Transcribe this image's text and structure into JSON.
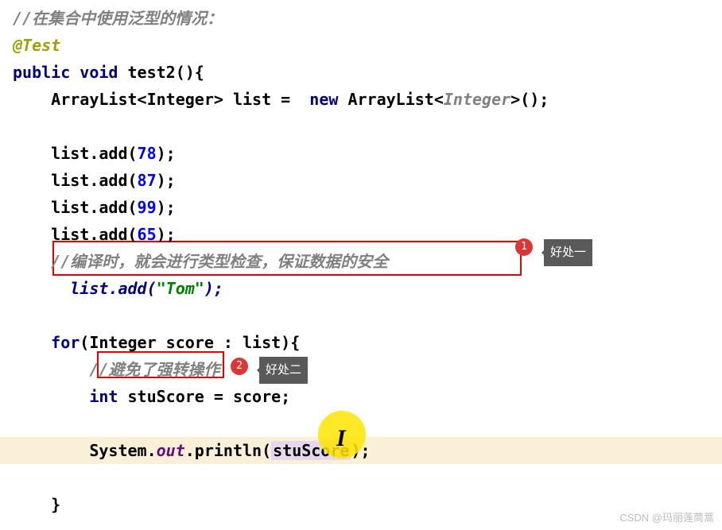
{
  "code": {
    "line1_comment": "//在集合中使用泛型的情况：",
    "line2_annotation": "@Test",
    "line3_public": "public",
    "line3_void": "void",
    "line3_method": "test2(){",
    "line4_pre": "    ArrayList<Integer> list = ",
    "line4_new": "new",
    "line4_post": " ArrayList<",
    "line4_integer": "Integer",
    "line4_end": ">();",
    "line6": "    list.add(",
    "line6_num": "78",
    "line6_end": ");",
    "line7": "    list.add(",
    "line7_num": "87",
    "line7_end": ");",
    "line8": "    list.add(",
    "line8_num": "99",
    "line8_end": ");",
    "line9": "    list.add(",
    "line9_num": "65",
    "line9_end": ");",
    "line10_comment": "    //编译时，就会进行类型检查，保证数据的安全",
    "line11_pre": "      list.add(",
    "line11_str": "\"Tom\"",
    "line11_end": ");",
    "line13_for": "for",
    "line13_rest": "(Integer score : list){",
    "line14_comment": "        //避免了强转操作",
    "line15_int": "int",
    "line15_rest": " stuScore = score;",
    "line17_pre": "        System.",
    "line17_out": "out",
    "line17_mid": ".println(",
    "line17_var": "stuScore",
    "line17_end": ");",
    "line19": "    }"
  },
  "annotations": {
    "badge1": "1",
    "label1": "好处一",
    "badge2": "2",
    "label2": "好处二"
  },
  "watermark": "CSDN @玛丽莲茼蒿"
}
